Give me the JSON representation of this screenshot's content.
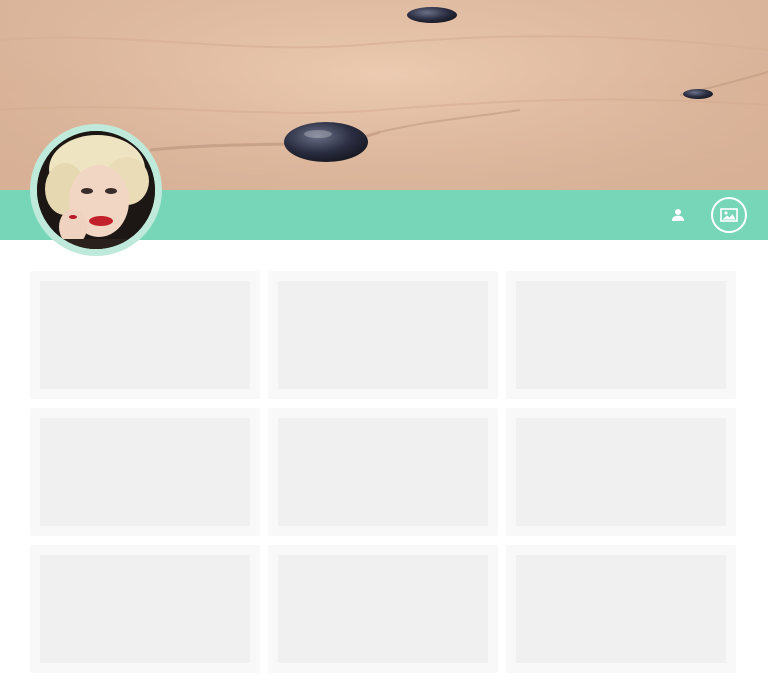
{
  "profile": {
    "cover": {
      "scene": "sand-with-pebbles"
    },
    "avatar": {
      "alt": ""
    },
    "accent_color": "#78d6b8"
  },
  "toolbar": {
    "profile_icon": "user-icon",
    "cover_photo_icon": "image-icon"
  },
  "grid": {
    "columns": 3,
    "rows": 3,
    "tiles": [
      {
        "state": "loading"
      },
      {
        "state": "loading"
      },
      {
        "state": "loading"
      },
      {
        "state": "loading"
      },
      {
        "state": "loading"
      },
      {
        "state": "loading"
      },
      {
        "state": "loading"
      },
      {
        "state": "loading"
      },
      {
        "state": "loading"
      }
    ]
  }
}
